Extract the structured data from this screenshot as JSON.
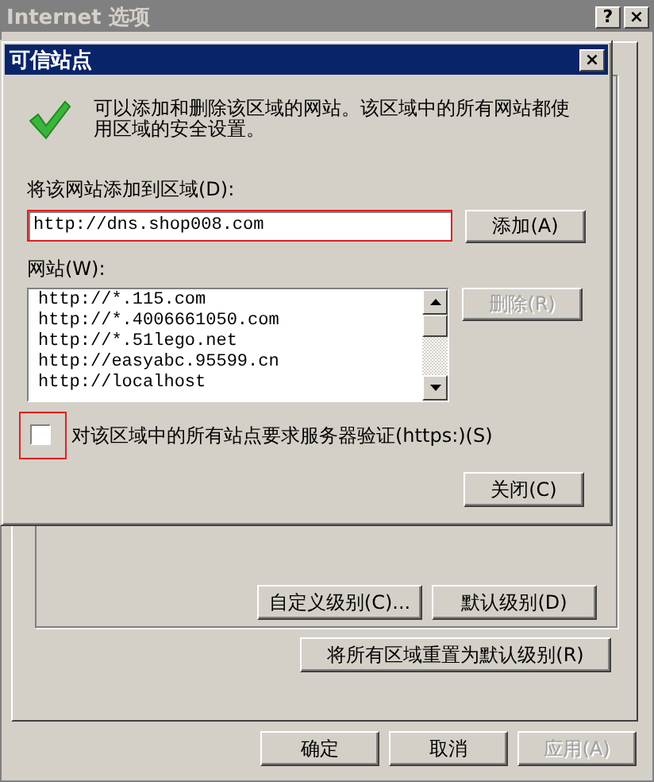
{
  "window": {
    "title": "Internet 选项",
    "help_button": "?",
    "close_button": "×"
  },
  "dialog": {
    "title": "可信站点",
    "close_button": "×",
    "message": "可以添加和删除该区域的网站。该区域中的所有网站都使用区域的安全设置。",
    "add_label": "将该网站添加到区域(D):",
    "add_field": {
      "value": "http://dns.shop008.com",
      "highlighted": true
    },
    "add_button": {
      "label": "添加(A)",
      "disabled": false
    },
    "sites_label": "网站(W):",
    "sites": [
      "http://*.115.com",
      "http://*.4006661050.com",
      "http://*.51lego.net",
      "http://easyabc.95599.cn",
      "http://localhost"
    ],
    "remove_button": {
      "label": "删除(R)",
      "disabled": true
    },
    "https_checkbox": {
      "label": "对该区域中的所有站点要求服务器验证(https:)(S)",
      "checked": false,
      "highlighted": true
    },
    "close_dialog_button": {
      "label": "关闭(C)",
      "disabled": false
    }
  },
  "level_buttons": [
    {
      "label": "自定义级别(C)...",
      "disabled": false
    },
    {
      "label": "默认级别(D)",
      "disabled": false
    }
  ],
  "reset_button": {
    "label": "将所有区域重置为默认级别(R)",
    "disabled": false
  },
  "buttons": [
    {
      "label": "确定",
      "disabled": false
    },
    {
      "label": "取消",
      "disabled": false
    },
    {
      "label": "应用(A)",
      "disabled": true
    }
  ]
}
